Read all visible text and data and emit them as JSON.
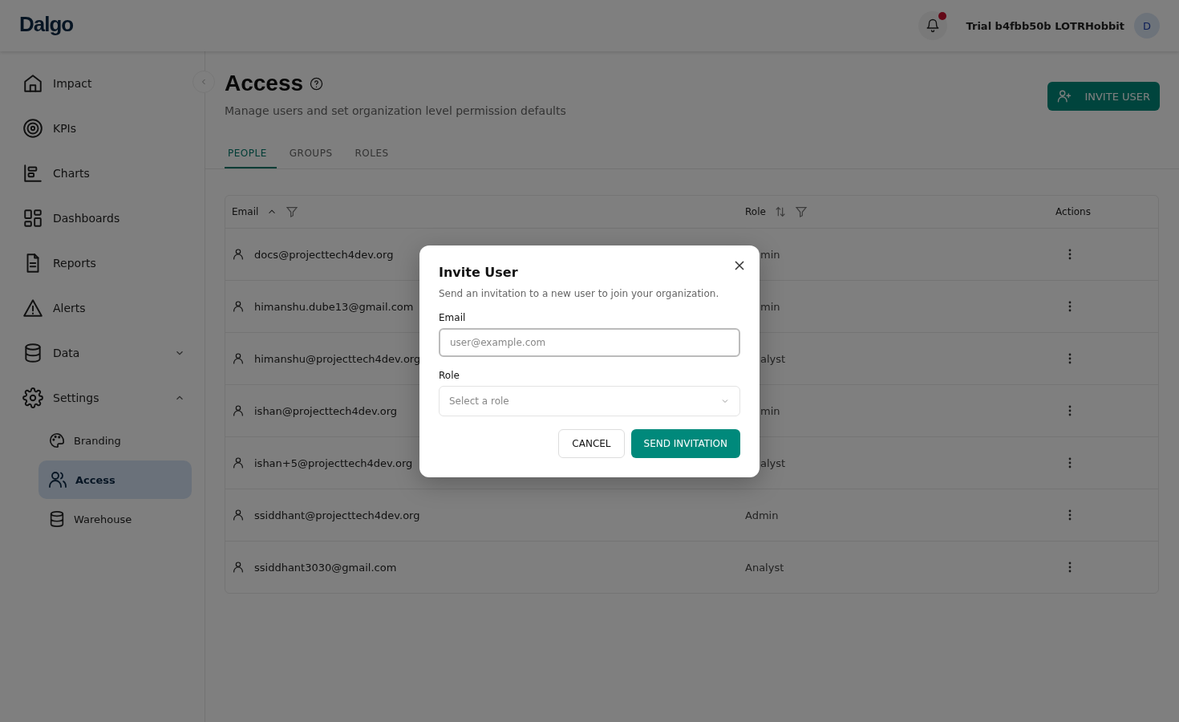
{
  "header": {
    "logo": "Dalgo",
    "has_unread": true,
    "org_name": "Trial b4fbb50b LOTRHobbit",
    "avatar": "D"
  },
  "sidebar": {
    "items": [
      {
        "label": "Impact",
        "selected": false
      },
      {
        "label": "KPIs",
        "selected": false
      },
      {
        "label": "Charts",
        "selected": false
      },
      {
        "label": "Dashboards",
        "selected": false
      },
      {
        "label": "Reports",
        "selected": false
      },
      {
        "label": "Alerts",
        "selected": false
      },
      {
        "label": "Data",
        "selected": false,
        "expanded": false
      },
      {
        "label": "Settings",
        "selected": false,
        "expanded": true,
        "children": [
          {
            "label": "Branding",
            "selected": false
          },
          {
            "label": "Access",
            "selected": true
          },
          {
            "label": "Warehouse",
            "selected": false
          }
        ]
      }
    ]
  },
  "page": {
    "title": "Access",
    "subtitle": "Manage users and set organization level permission defaults",
    "invite_button": "INVITE USER"
  },
  "tabs": [
    {
      "label": "PEOPLE",
      "selected": true
    },
    {
      "label": "GROUPS",
      "selected": false
    },
    {
      "label": "ROLES",
      "selected": false
    }
  ],
  "table": {
    "columns": [
      {
        "label": "Email",
        "sortable": true,
        "sorted": true,
        "filter": true
      },
      {
        "label": "Role",
        "sortable": true,
        "sorted": false,
        "filter": true
      },
      {
        "label": "Actions",
        "sortable": false,
        "filter": false
      }
    ],
    "rows": [
      {
        "email": "docs@projecttech4dev.org",
        "role": "min",
        "kind": "covered"
      },
      {
        "email": "himanshu.dube13@gmail.com",
        "role": "min",
        "kind": "covered"
      },
      {
        "email": "himanshu@projecttech4dev.org",
        "role": "alyst",
        "kind": "covered"
      },
      {
        "email": "ishan@projecttech4dev.org",
        "role": "min",
        "kind": "covered"
      },
      {
        "email": "ishan+5@projecttech4dev.org",
        "role": "alyst",
        "kind": "covered"
      },
      {
        "email": "ssiddhant@projecttech4dev.org",
        "role": "Admin",
        "kind": "plain"
      },
      {
        "email": "ssiddhant3030@gmail.com",
        "role": "Analyst",
        "kind": "plain"
      }
    ]
  },
  "dialog": {
    "title": "Invite User",
    "description": "Send an invitation to a new user to join your organization.",
    "email_label": "Email",
    "email_placeholder": "user@example.com",
    "role_label": "Role",
    "role_placeholder": "Select a role",
    "cancel": "CANCEL",
    "submit": "SEND INVITATION"
  }
}
